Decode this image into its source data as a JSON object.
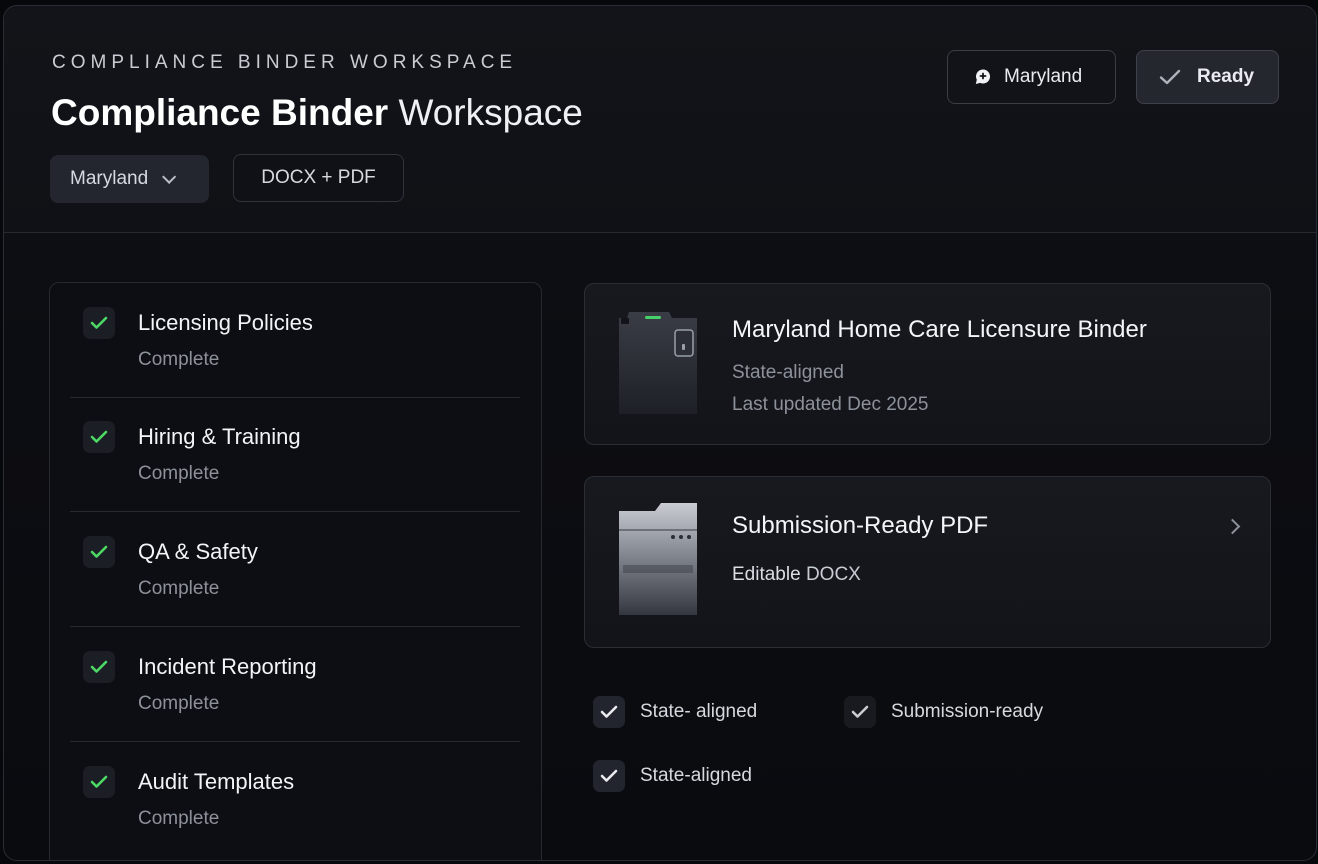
{
  "header": {
    "eyebrow": "COMPLIANCE BINDER WORKSPACE",
    "title_strong": "Compliance Binder",
    "title_light": "Workspace",
    "state_select": {
      "label": "Maryland"
    },
    "format_label": "DOCX + PDF",
    "state_button_label": "Maryland",
    "ready_button_label": "Ready"
  },
  "checklist": [
    {
      "label": "Licensing Policies",
      "status": "Complete"
    },
    {
      "label": "Hiring & Training",
      "status": "Complete"
    },
    {
      "label": "QA & Safety",
      "status": "Complete"
    },
    {
      "label": "Incident Reporting",
      "status": "Complete"
    },
    {
      "label": "Audit Templates",
      "status": "Complete"
    }
  ],
  "binder_card": {
    "title": "Maryland Home Care Licensure Binder",
    "line1": "State-aligned",
    "line2": "Last updated Dec 2025"
  },
  "pdf_card": {
    "title": "Submission-Ready PDF",
    "line_a": "Editable",
    "line_b": "DOCX"
  },
  "tags": [
    {
      "label": "State- aligned"
    },
    {
      "label": "Submission-ready"
    },
    {
      "label": "State-aligned"
    }
  ],
  "colors": {
    "check_green": "#4cd964",
    "background": "#07080c",
    "panel": "#0c0e13",
    "muted_text": "#8d919a"
  }
}
